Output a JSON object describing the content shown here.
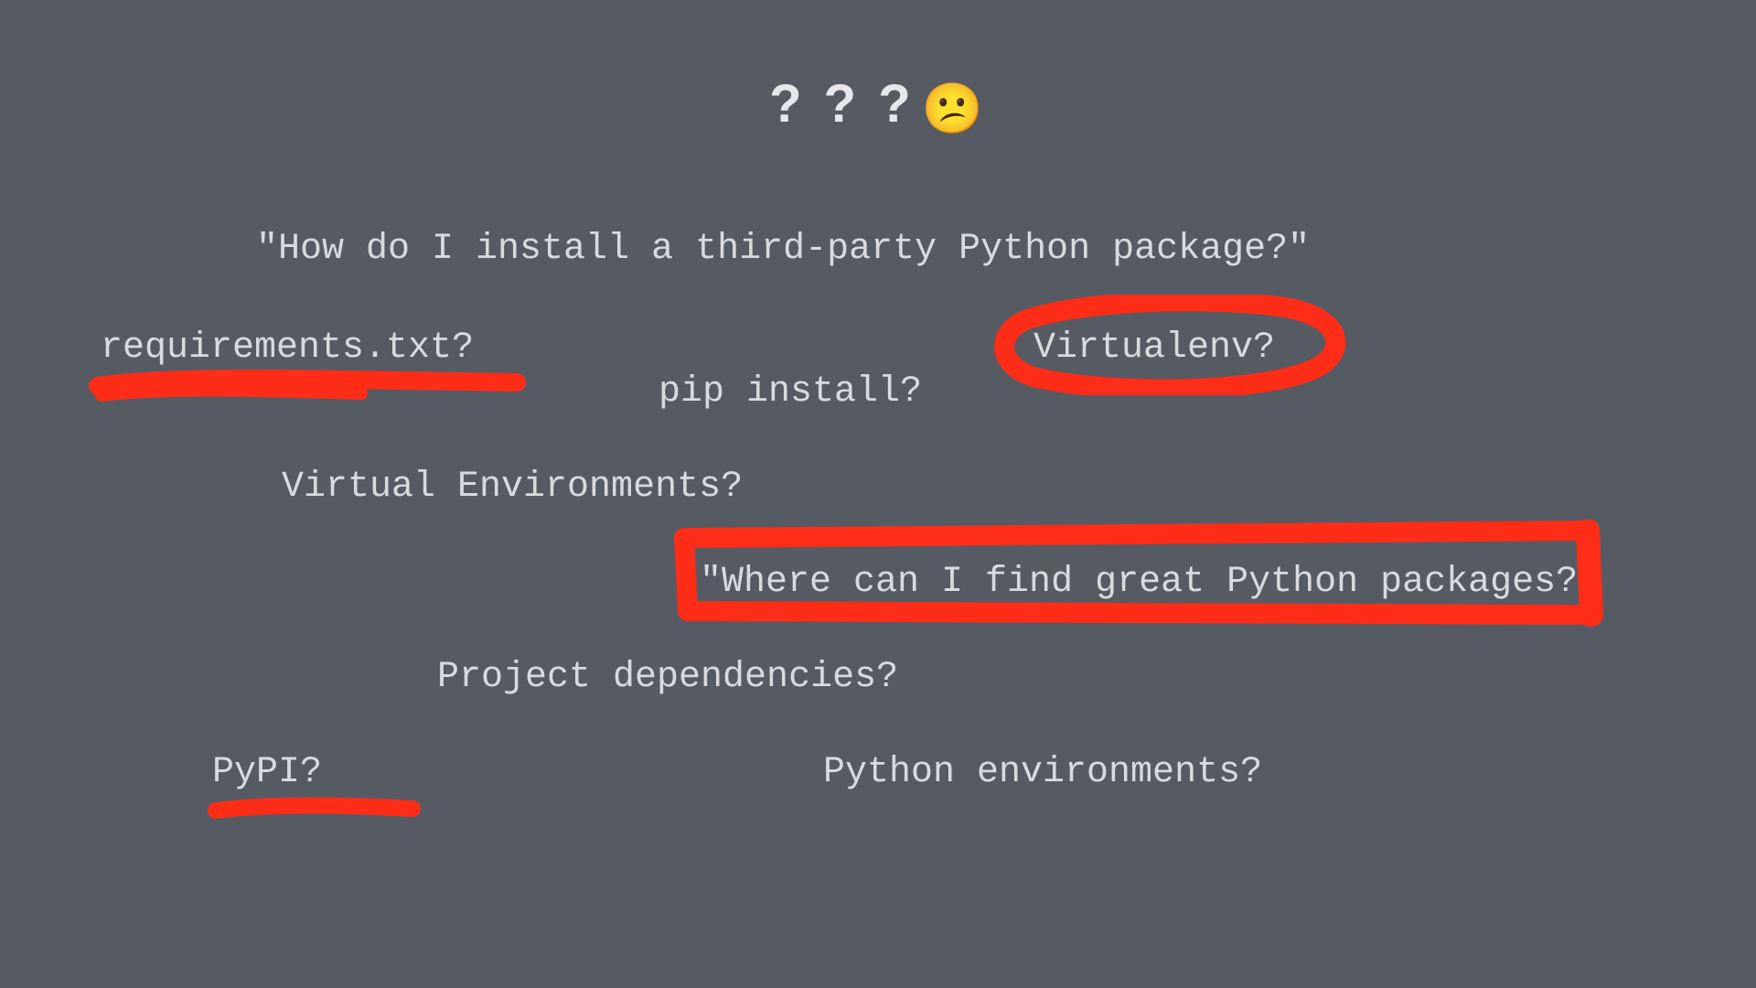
{
  "title": {
    "marks": "? ? ?",
    "emoji": "😕"
  },
  "terms": {
    "install_pkg": "\"How do I install a third-party Python package?\"",
    "requirements": "requirements.txt?",
    "virtualenv": "Virtualenv?",
    "pip_install": "pip install?",
    "virtual_envs": "Virtual Environments?",
    "find_packages": "\"Where can I find great Python packages?\"",
    "proj_deps": "Project dependencies?",
    "pypi": "PyPI?",
    "py_envs": "Python environments?"
  },
  "colors": {
    "bg": "#565b63",
    "text": "#d8dadd",
    "annot": "#fd2d18"
  }
}
